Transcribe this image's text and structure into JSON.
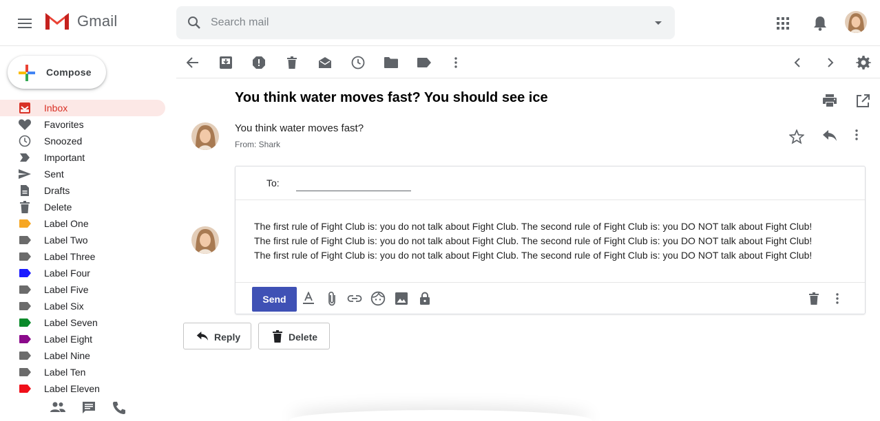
{
  "app": {
    "name": "Gmail"
  },
  "search": {
    "placeholder": "Search mail"
  },
  "compose": {
    "label": "Compose"
  },
  "sidebar": {
    "items": [
      {
        "label": "Inbox",
        "icon": "inbox-icon",
        "active": true
      },
      {
        "label": "Favorites",
        "icon": "heart-icon"
      },
      {
        "label": "Snoozed",
        "icon": "clock-icon"
      },
      {
        "label": "Important",
        "icon": "important-icon"
      },
      {
        "label": "Sent",
        "icon": "send-icon"
      },
      {
        "label": "Drafts",
        "icon": "draft-icon"
      },
      {
        "label": "Delete",
        "icon": "trash-icon"
      },
      {
        "label": "Label One",
        "icon": "label-icon",
        "color": "#f6a623"
      },
      {
        "label": "Label Two",
        "icon": "label-icon",
        "color": "#6b6b6b"
      },
      {
        "label": "Label Three",
        "icon": "label-icon",
        "color": "#6b6b6b"
      },
      {
        "label": "Label Four",
        "icon": "label-icon",
        "color": "#1a1aff"
      },
      {
        "label": "Label Five",
        "icon": "label-icon",
        "color": "#6b6b6b"
      },
      {
        "label": "Label Six",
        "icon": "label-icon",
        "color": "#6b6b6b"
      },
      {
        "label": "Label Seven",
        "icon": "label-icon",
        "color": "#0a8a2a"
      },
      {
        "label": "Label Eight",
        "icon": "label-icon",
        "color": "#8b0a8b"
      },
      {
        "label": "Label Nine",
        "icon": "label-icon",
        "color": "#6b6b6b"
      },
      {
        "label": "Label Ten",
        "icon": "label-icon",
        "color": "#6b6b6b"
      },
      {
        "label": "Label Eleven",
        "icon": "label-icon",
        "color": "#f0101a"
      }
    ]
  },
  "email": {
    "subject": "You think water moves fast? You should see ice",
    "message": "You think water moves fast?",
    "from": "From: Shark"
  },
  "reply": {
    "to_label": "To:",
    "to_value": "",
    "body_lines": [
      "The first rule of Fight Club is: you do not talk about Fight Club. The second rule of Fight Club is: you DO NOT talk about Fight Club!",
      "The first rule of Fight Club is: you do not talk about Fight Club. The second rule of Fight Club is: you DO NOT talk about Fight Club!",
      "The first rule of Fight Club is: you do not talk about Fight Club. The second rule of Fight Club is: you DO NOT talk about Fight Club!"
    ],
    "send_label": "Send"
  },
  "actions": {
    "reply_label": "Reply",
    "delete_label": "Delete"
  },
  "colors": {
    "accent": "#3f51b5",
    "inbox_active": "#d93025",
    "inbox_bg": "#fce8e6"
  }
}
